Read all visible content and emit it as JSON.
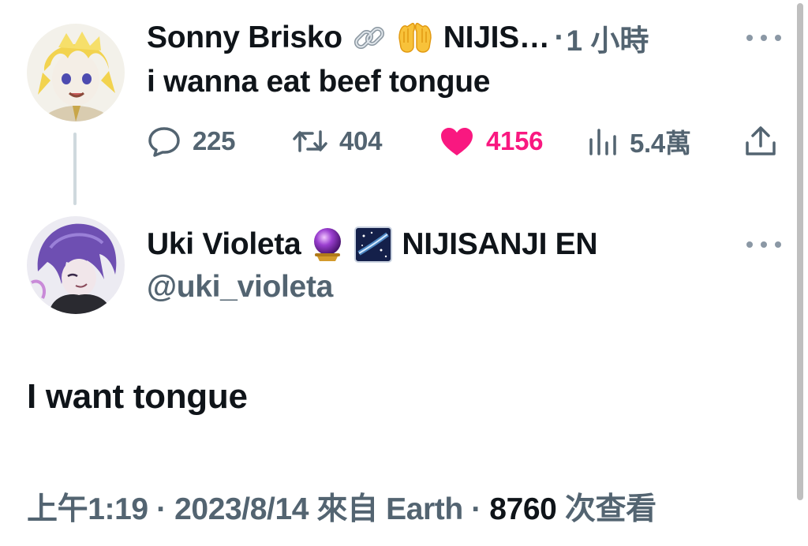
{
  "reply_to": {
    "display_name": "Sonny Brisko",
    "emojis": [
      "link-emoji",
      "raising-hands-emoji"
    ],
    "affiliation": "NIJIS…",
    "separator": "·",
    "time_ago": "1 小時",
    "text": "i wanna eat beef tongue",
    "actions": {
      "replies": "225",
      "retweets": "404",
      "likes": "4156",
      "views": "5.4萬"
    },
    "like_color": "#f91880"
  },
  "tweet": {
    "display_name": "Uki Violeta",
    "emojis": [
      "crystal-ball-emoji",
      "milky-way-emoji"
    ],
    "affiliation": "NIJISANJI EN",
    "handle": "@uki_violeta",
    "text": "I want tongue",
    "meta": {
      "time": "上午1:19",
      "sep1": "·",
      "date": "2023/8/14",
      "source_prefix": "來自",
      "source": "Earth",
      "sep2": "·",
      "views_count": "8760",
      "views_label": "次查看"
    }
  },
  "colors": {
    "text_primary": "#0f1419",
    "text_secondary": "#536471",
    "thread_line": "#cfd9de"
  }
}
